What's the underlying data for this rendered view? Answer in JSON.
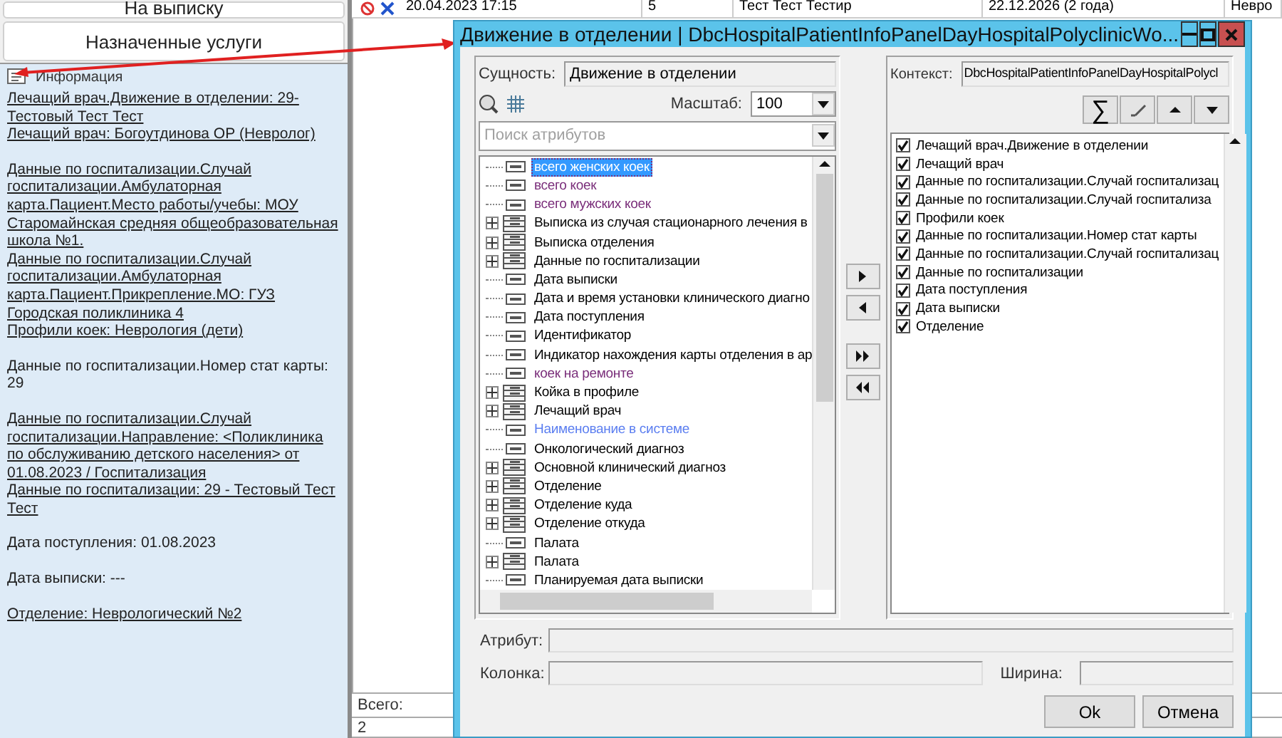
{
  "left_panel": {
    "buttons": [
      {
        "label": "На выписку"
      },
      {
        "label": "Назначенные услуги"
      }
    ],
    "info": {
      "title": "Информация",
      "groups": [
        {
          "lines": [
            {
              "text": "Лечащий врач.Движение в отделении: 29-Тестовый Тест Тест",
              "link": true
            },
            {
              "text": "Лечащий врач: Богоутдинова ОР (Невролог)",
              "link": true
            }
          ]
        },
        {
          "lines": [
            {
              "text": "Данные по госпитализации.Случай госпитализации.Амбулаторная карта.Пациент.Место работы/учебы: МОУ Старомайнская средняя общеобразовательная школа №1.",
              "link": true
            },
            {
              "text": "Данные по госпитализации.Случай госпитализации.Амбулаторная карта.Пациент.Прикрепление.МО: ГУЗ Городская поликлиника 4",
              "link": true
            },
            {
              "text": "Профили коек: Неврология (дети)",
              "link": true
            }
          ]
        },
        {
          "lines": [
            {
              "text": "Данные по госпитализации.Номер стат карты: 29",
              "link": false
            }
          ]
        },
        {
          "lines": [
            {
              "text": "Данные по госпитализации.Случай госпитализации.Направление: <Поликлиника по обслуживанию детского населения>  от 01.08.2023 / Госпитализация",
              "link": true
            },
            {
              "text": "Данные по госпитализации: 29 - Тестовый Тест Тест",
              "link": true
            }
          ]
        },
        {
          "lines": [
            {
              "text": "Дата поступления: 01.08.2023",
              "link": false
            }
          ]
        },
        {
          "lines": [
            {
              "text": "Дата выписки: ---",
              "link": false
            }
          ]
        },
        {
          "lines": [
            {
              "text": "Отделение: Неврологический №2",
              "link": true
            }
          ]
        }
      ]
    }
  },
  "table": {
    "row": [
      "20.04.2023 17:15",
      "5",
      "Тест Тест Тестир",
      "22.12.2026 (2 года)",
      "Невро"
    ],
    "total_label": "Всего:",
    "total_value": "2"
  },
  "dialog": {
    "title": "Движение в отделении | DbcHospitalPatientInfoPanelDayHospitalPolyclinicWo...",
    "entity_label": "Сущность:",
    "entity_value": "Движение в отделении",
    "scale_label": "Масштаб:",
    "scale_value": "100",
    "search": {
      "placeholder": "Поиск атрибутов"
    },
    "tree": [
      {
        "label": "всего женских коек",
        "kind": "field",
        "selected": true,
        "color": "#7a2e7a"
      },
      {
        "label": "всего коек",
        "kind": "field",
        "selected": false,
        "color": "#7a2e7a"
      },
      {
        "label": "всего мужских коек",
        "kind": "field",
        "selected": false,
        "color": "#7a2e7a"
      },
      {
        "label": "Выписка из случая стационарного лечения в",
        "kind": "group",
        "selected": false,
        "color": "#000000"
      },
      {
        "label": "Выписка отделения",
        "kind": "group",
        "selected": false,
        "color": "#000000"
      },
      {
        "label": "Данные по госпитализации",
        "kind": "group",
        "selected": false,
        "color": "#000000"
      },
      {
        "label": "Дата выписки",
        "kind": "field",
        "selected": false,
        "color": "#000000"
      },
      {
        "label": "Дата и время установки клинического диагно",
        "kind": "field",
        "selected": false,
        "color": "#000000"
      },
      {
        "label": "Дата поступления",
        "kind": "field",
        "selected": false,
        "color": "#000000"
      },
      {
        "label": "Идентификатор",
        "kind": "field",
        "selected": false,
        "color": "#000000"
      },
      {
        "label": "Индикатор нахождения карты отделения в ар",
        "kind": "field",
        "selected": false,
        "color": "#000000"
      },
      {
        "label": "коек на ремонте",
        "kind": "field",
        "selected": false,
        "color": "#7a2e7a"
      },
      {
        "label": "Койка в профиле",
        "kind": "group",
        "selected": false,
        "color": "#000000"
      },
      {
        "label": "Лечащий врач",
        "kind": "group",
        "selected": false,
        "color": "#000000"
      },
      {
        "label": "Наименование в системе",
        "kind": "field",
        "selected": false,
        "color": "#5b7ef0"
      },
      {
        "label": "Онкологический диагноз",
        "kind": "field",
        "selected": false,
        "color": "#000000"
      },
      {
        "label": "Основной клинический диагноз",
        "kind": "group",
        "selected": false,
        "color": "#000000"
      },
      {
        "label": "Отделение",
        "kind": "group",
        "selected": false,
        "color": "#000000"
      },
      {
        "label": "Отделение куда",
        "kind": "group",
        "selected": false,
        "color": "#000000"
      },
      {
        "label": "Отделение откуда",
        "kind": "group",
        "selected": false,
        "color": "#000000"
      },
      {
        "label": "Палата",
        "kind": "field",
        "selected": false,
        "color": "#000000"
      },
      {
        "label": "Палата",
        "kind": "group",
        "selected": false,
        "color": "#000000"
      },
      {
        "label": "Планируемая дата выписки",
        "kind": "field",
        "selected": false,
        "color": "#000000"
      }
    ],
    "context_label": "Контекст:",
    "context_value": "DbcHospitalPatientInfoPanelDayHospitalPolycl",
    "sum_symbol": "∑",
    "columns": [
      {
        "label": "Лечащий врач.Движение в отделении",
        "checked": true
      },
      {
        "label": "Лечащий врач",
        "checked": true
      },
      {
        "label": "Данные по госпитализации.Случай госпитализац",
        "checked": true
      },
      {
        "label": "Данные по госпитализации.Случай госпитализа",
        "checked": true
      },
      {
        "label": "Профили коек",
        "checked": true
      },
      {
        "label": "Данные по госпитализации.Номер стат карты",
        "checked": true
      },
      {
        "label": "Данные по госпитализации.Случай госпитализац",
        "checked": true
      },
      {
        "label": "Данные по госпитализации",
        "checked": true
      },
      {
        "label": "Дата поступления",
        "checked": true
      },
      {
        "label": "Дата выписки",
        "checked": true
      },
      {
        "label": "Отделение",
        "checked": true
      }
    ],
    "attribute_label": "Атрибут:",
    "column_label": "Колонка:",
    "width_label": "Ширина:",
    "buttons": [
      {
        "label": "Ok"
      },
      {
        "label": "Отмена"
      }
    ]
  }
}
